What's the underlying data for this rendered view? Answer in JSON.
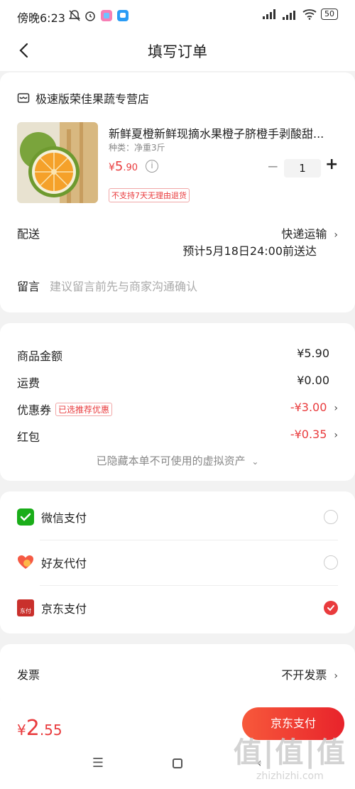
{
  "status_bar": {
    "time": "傍晚6:23",
    "signal_label": "HD",
    "battery": "50"
  },
  "header": {
    "title": "填写订单"
  },
  "order": {
    "store_name": "极速版荣佳果蔬专营店",
    "product_name": "新鲜夏橙新鲜现摘水果橙子脐橙手剥酸甜...",
    "spec": "种类：净重3斤",
    "price_symbol": "¥",
    "price_int": "5",
    "price_dec": ".90",
    "quantity": "1",
    "return_tag": "不支持7天无理由退货",
    "delivery_label": "配送",
    "delivery_method": "快递运输",
    "delivery_eta": "预计5月18日24:00前送达",
    "remark_label": "留言",
    "remark_placeholder": "建议留言前先与商家沟通确认"
  },
  "summary": {
    "goods_label": "商品金额",
    "goods_value": "¥5.90",
    "shipping_label": "运费",
    "shipping_value": "¥0.00",
    "coupon_label": "优惠券",
    "coupon_tag": "已选推荐优惠",
    "coupon_value": "-¥3.00",
    "redpacket_label": "红包",
    "redpacket_value": "-¥0.35",
    "hidden_assets": "已隐藏本单不可使用的虚拟资产"
  },
  "payment": {
    "methods": [
      {
        "label": "微信支付",
        "checked": false
      },
      {
        "label": "好友代付",
        "checked": false
      },
      {
        "label": "京东支付",
        "checked": true
      }
    ],
    "jd_icon_text": "东付"
  },
  "invoice": {
    "label": "发票",
    "value": "不开发票"
  },
  "footer": {
    "currency": "¥",
    "total_int": "2",
    "total_dec": ".55",
    "pay_button": "京东支付",
    "watermark_big": "值|值|值",
    "watermark_small": "zhizhizhi.com"
  },
  "colors": {
    "accent": "#e93b3d",
    "wechat": "#1aad19"
  }
}
